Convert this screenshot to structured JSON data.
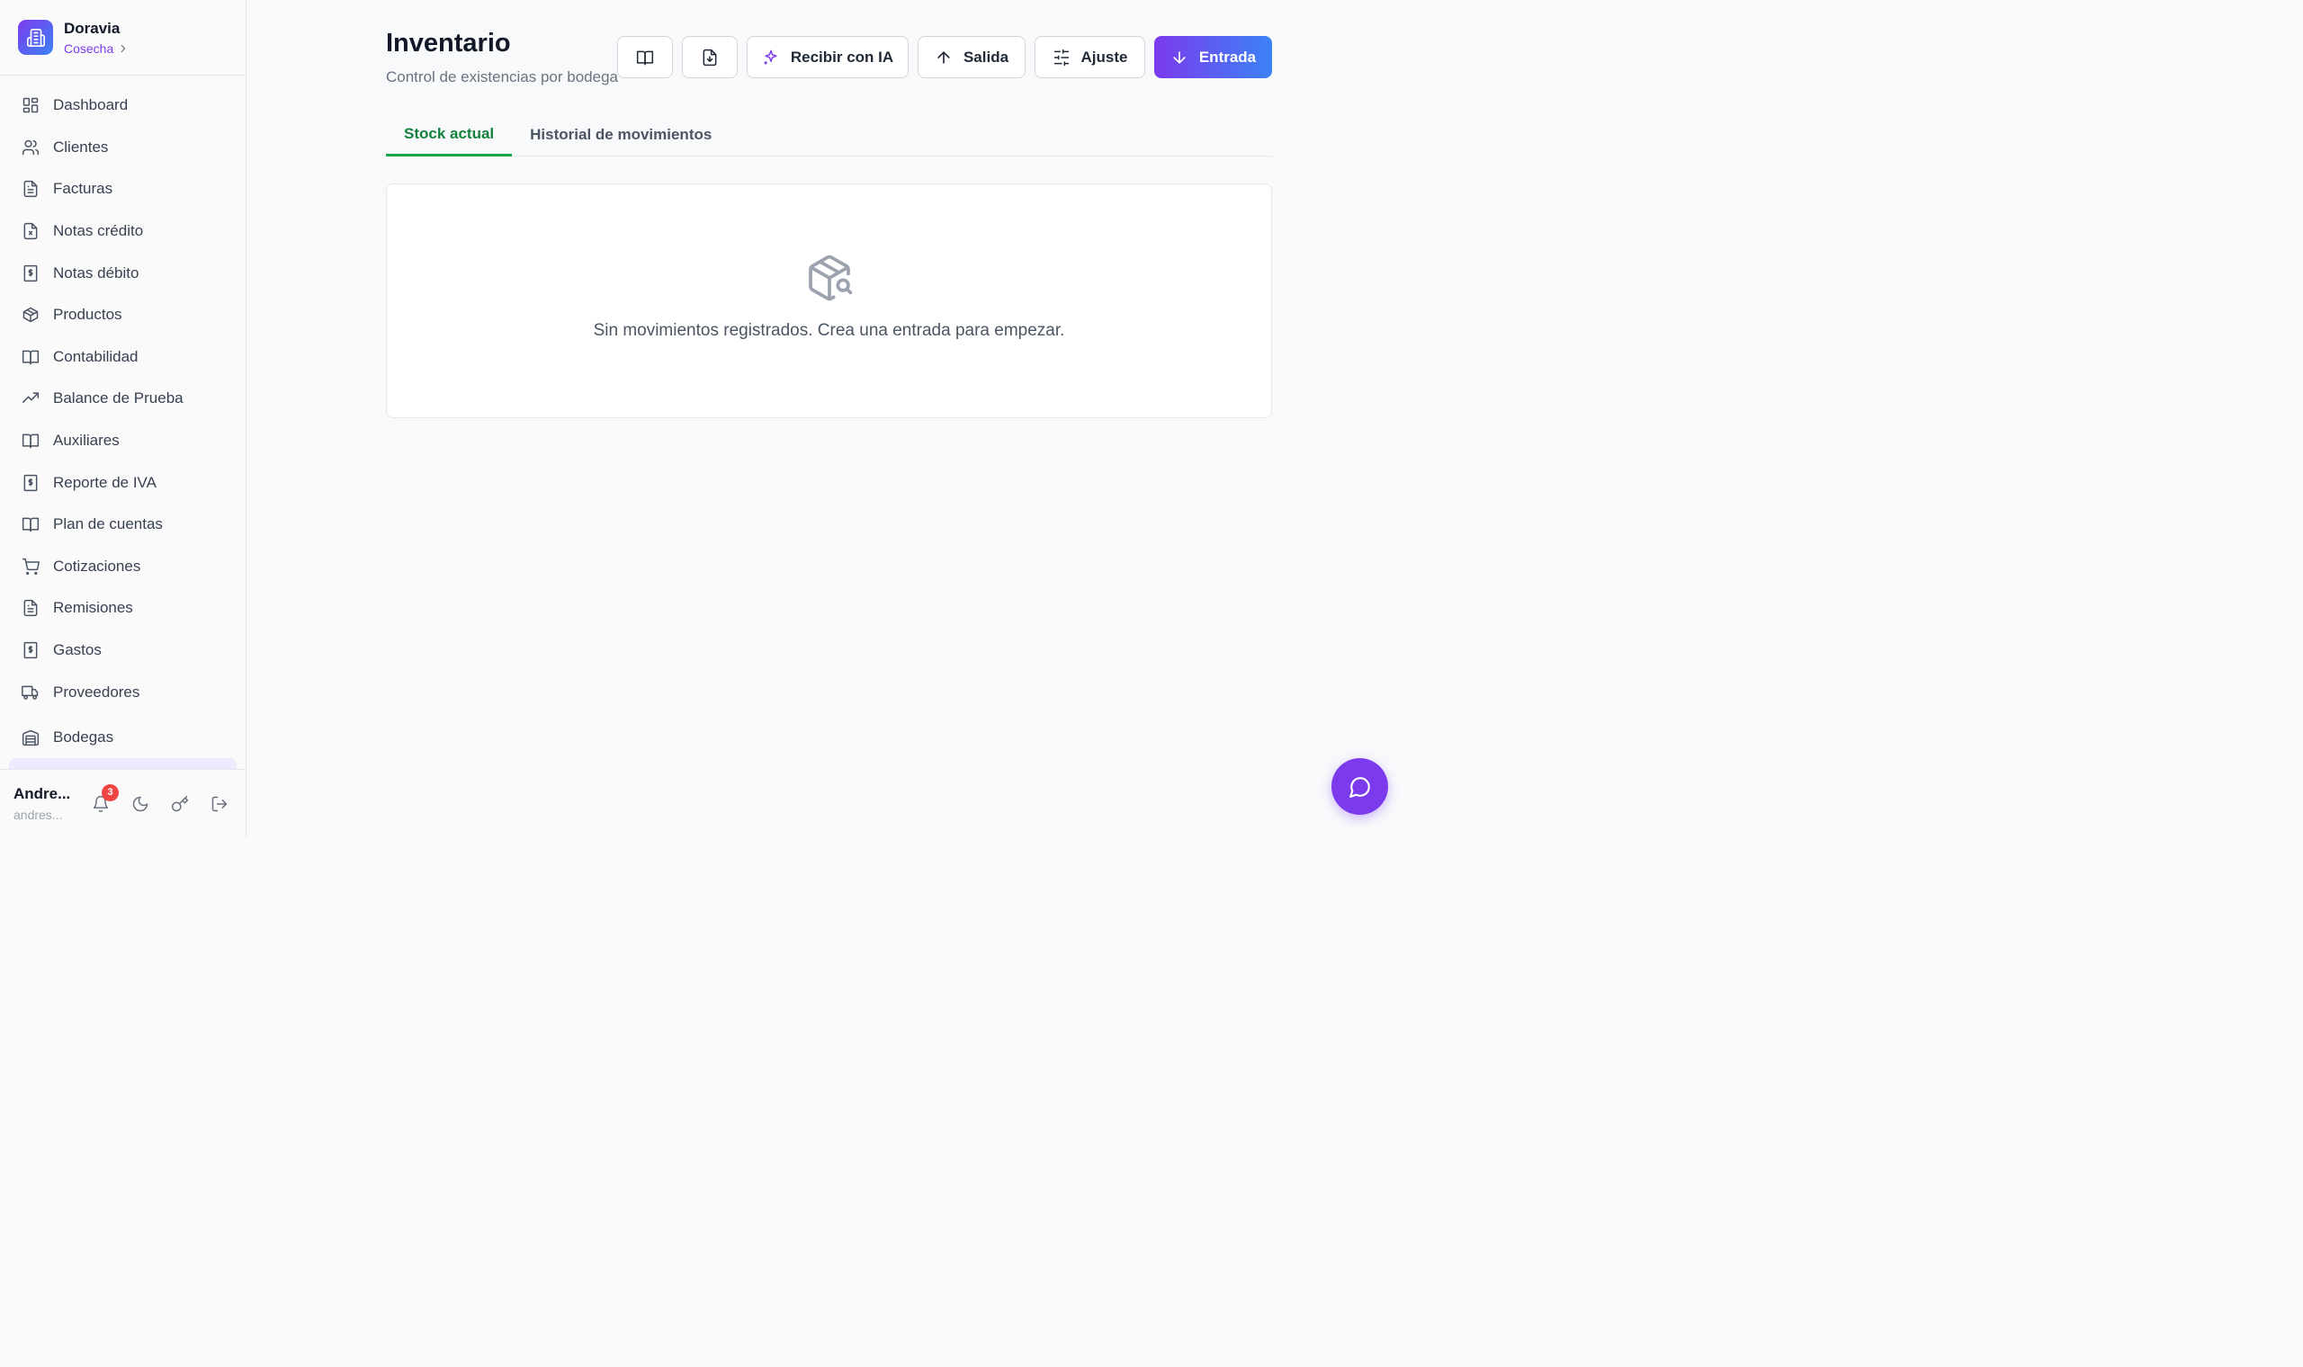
{
  "brand": {
    "name": "Doravia",
    "org": "Cosecha",
    "org_icon": "chevron-right-icon"
  },
  "sidebar": {
    "items": [
      {
        "label": "Dashboard",
        "icon": "dashboard-icon"
      },
      {
        "label": "Clientes",
        "icon": "users-icon"
      },
      {
        "label": "Facturas",
        "icon": "file-text-icon"
      },
      {
        "label": "Notas crédito",
        "icon": "file-x-icon"
      },
      {
        "label": "Notas débito",
        "icon": "receipt-icon"
      },
      {
        "label": "Productos",
        "icon": "package-icon"
      },
      {
        "label": "Contabilidad",
        "icon": "book-icon"
      },
      {
        "label": "Balance de Prueba",
        "icon": "trending-up-icon"
      },
      {
        "label": "Auxiliares",
        "icon": "book-icon"
      },
      {
        "label": "Reporte de IVA",
        "icon": "receipt-icon"
      },
      {
        "label": "Plan de cuentas",
        "icon": "book-icon"
      },
      {
        "label": "Cotizaciones",
        "icon": "cart-icon"
      },
      {
        "label": "Remisiones",
        "icon": "file-text-icon"
      },
      {
        "label": "Gastos",
        "icon": "receipt-icon"
      },
      {
        "label": "Proveedores",
        "icon": "truck-icon"
      },
      {
        "label": "Bodegas",
        "icon": "warehouse-icon"
      }
    ]
  },
  "user": {
    "name": "Andre...",
    "email": "andres...",
    "notifications": "3"
  },
  "page": {
    "title": "Inventario",
    "subtitle": "Control de existencias por bodega"
  },
  "toolbar": {
    "ia_label": "Recibir con IA",
    "salida_label": "Salida",
    "ajuste_label": "Ajuste",
    "entrada_label": "Entrada"
  },
  "tabs": [
    {
      "label": "Stock actual",
      "active": true
    },
    {
      "label": "Historial de movimientos",
      "active": false
    }
  ],
  "empty_state": {
    "message": "Sin movimientos registrados. Crea una entrada para empezar."
  },
  "colors": {
    "accent": "#7c3aed",
    "accent_end": "#3b82f6",
    "active_tab": "#16a34a",
    "badge": "#ef4444"
  }
}
